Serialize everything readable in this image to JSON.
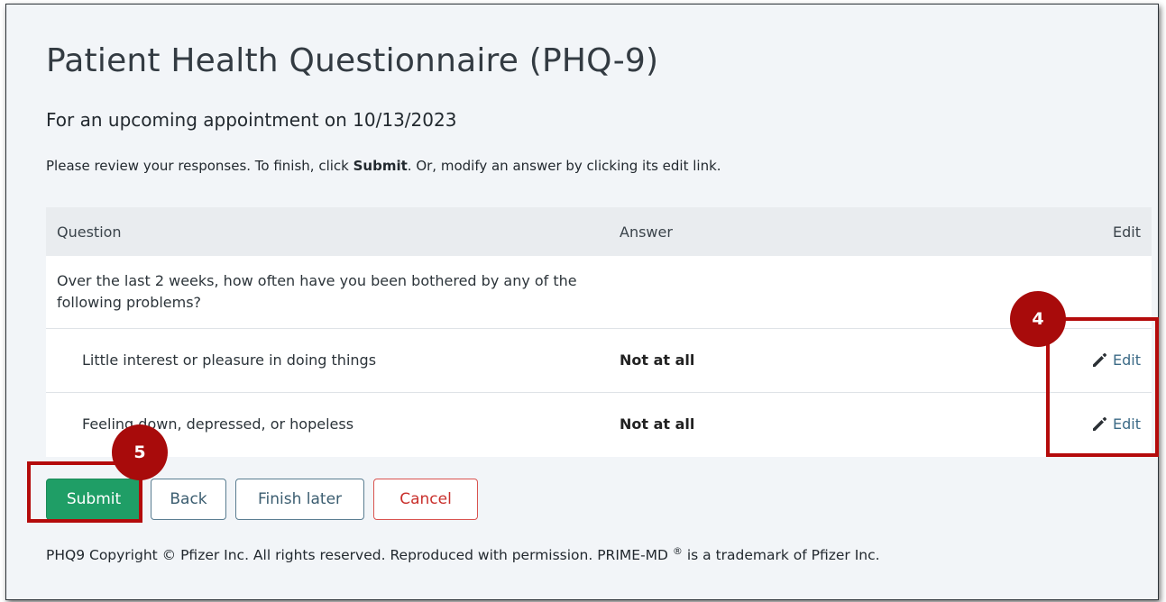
{
  "title": "Patient Health Questionnaire (PHQ-9)",
  "subtitle": "For an upcoming appointment on 10/13/2023",
  "instructions": {
    "before": "Please review your responses. To finish, click ",
    "bold": "Submit",
    "after": ". Or, modify an answer by clicking its edit link."
  },
  "table": {
    "headers": {
      "question": "Question",
      "answer": "Answer",
      "edit": "Edit"
    },
    "intro": "Over the last 2 weeks, how often have you been bothered by any of the following problems?",
    "rows": [
      {
        "question": "Little interest or pleasure in doing things",
        "answer": "Not at all",
        "edit": "Edit"
      },
      {
        "question": "Feeling down, depressed, or hopeless",
        "answer": "Not at all",
        "edit": "Edit"
      }
    ]
  },
  "buttons": {
    "submit": "Submit",
    "back": "Back",
    "finish_later": "Finish later",
    "cancel": "Cancel"
  },
  "copyright": {
    "text": "PHQ9 Copyright © Pfizer Inc. All rights reserved. Reproduced with permission. PRIME-MD ",
    "sup": "®",
    "after": " is a trademark of Pfizer Inc."
  },
  "callouts": {
    "edit_step": "4",
    "submit_step": "5",
    "color": "#a80b0b"
  },
  "colors": {
    "submit": "#1f9e66",
    "cancel": "#d9534f",
    "link": "#3b6a86"
  }
}
